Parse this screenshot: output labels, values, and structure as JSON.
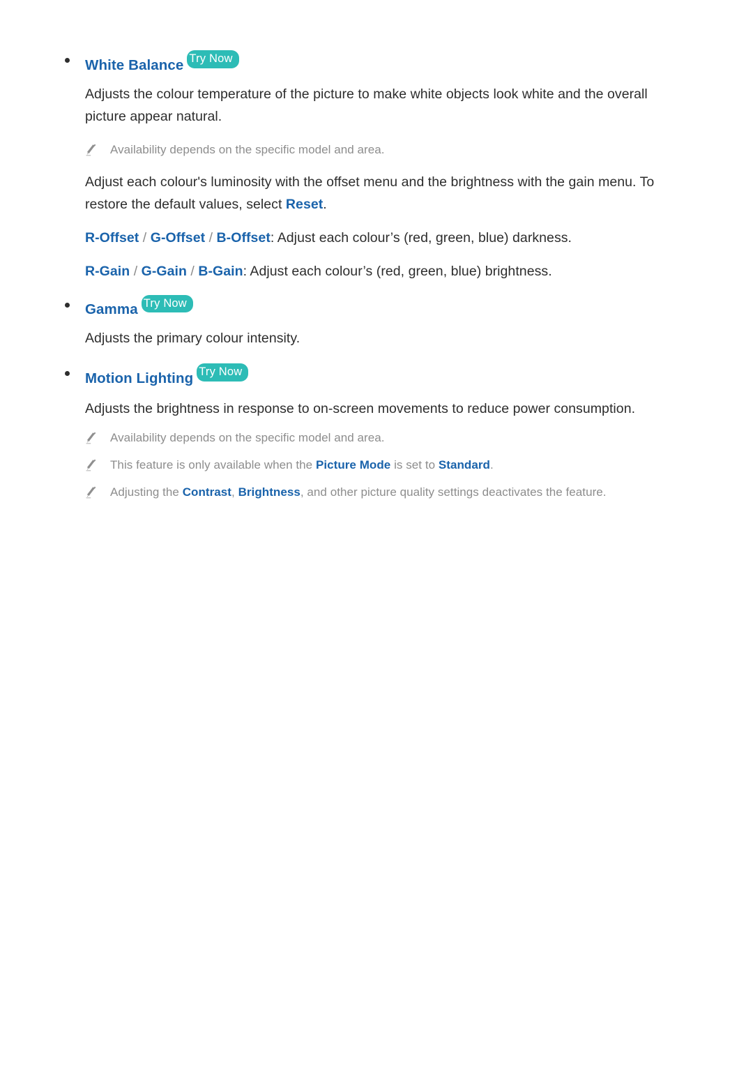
{
  "document": {
    "try_now_label": "Try Now",
    "accent_blue": "#1a63ab",
    "badge_teal": "#2dbcb6",
    "body_color": "#2d2d2d",
    "note_color": "#8d8d8d",
    "sections": [
      {
        "heading": "White Balance",
        "has_try_now": true,
        "body": "Adjusts the colour temperature of the picture to make white objects look white and the overall picture appear natural.",
        "note": "Availability depends on the specific model and area.",
        "body2_part1": "Adjust each colour's luminosity with the offset menu and the brightness with the gain menu. To restore the default values, select ",
        "body2_term": "Reset",
        "body2_part2": ".",
        "offset_terms": [
          "R-Offset",
          "G-Offset",
          "B-Offset"
        ],
        "offset_desc": ": Adjust each colour’s (red, green, blue) darkness.",
        "gain_terms": [
          "R-Gain",
          "G-Gain",
          "B-Gain"
        ],
        "gain_desc": ": Adjust each colour’s (red, green, blue) brightness.",
        "separator": "/"
      },
      {
        "heading": "Gamma",
        "has_try_now": true,
        "body": "Adjusts the primary colour intensity."
      },
      {
        "heading": "Motion Lighting",
        "has_try_now": true,
        "body": "Adjusts the brightness in response to on-screen movements to reduce power consumption.",
        "notes": [
          {
            "parts": [
              {
                "text": "Availability depends on the specific model and area.",
                "style": "plain"
              }
            ]
          },
          {
            "parts": [
              {
                "text": "This feature is only available when the ",
                "style": "plain"
              },
              {
                "text": "Picture Mode",
                "style": "term"
              },
              {
                "text": " is set to ",
                "style": "plain"
              },
              {
                "text": "Standard",
                "style": "term"
              },
              {
                "text": ".",
                "style": "plain"
              }
            ]
          },
          {
            "parts": [
              {
                "text": "Adjusting the ",
                "style": "plain"
              },
              {
                "text": "Contrast",
                "style": "term"
              },
              {
                "text": ", ",
                "style": "plain"
              },
              {
                "text": "Brightness",
                "style": "term"
              },
              {
                "text": ", and other picture quality settings deactivates the feature.",
                "style": "plain"
              }
            ]
          }
        ]
      }
    ],
    "icons": {
      "note_marker": "pencil-icon",
      "bullet_marker": "bullet-dot-icon"
    }
  }
}
